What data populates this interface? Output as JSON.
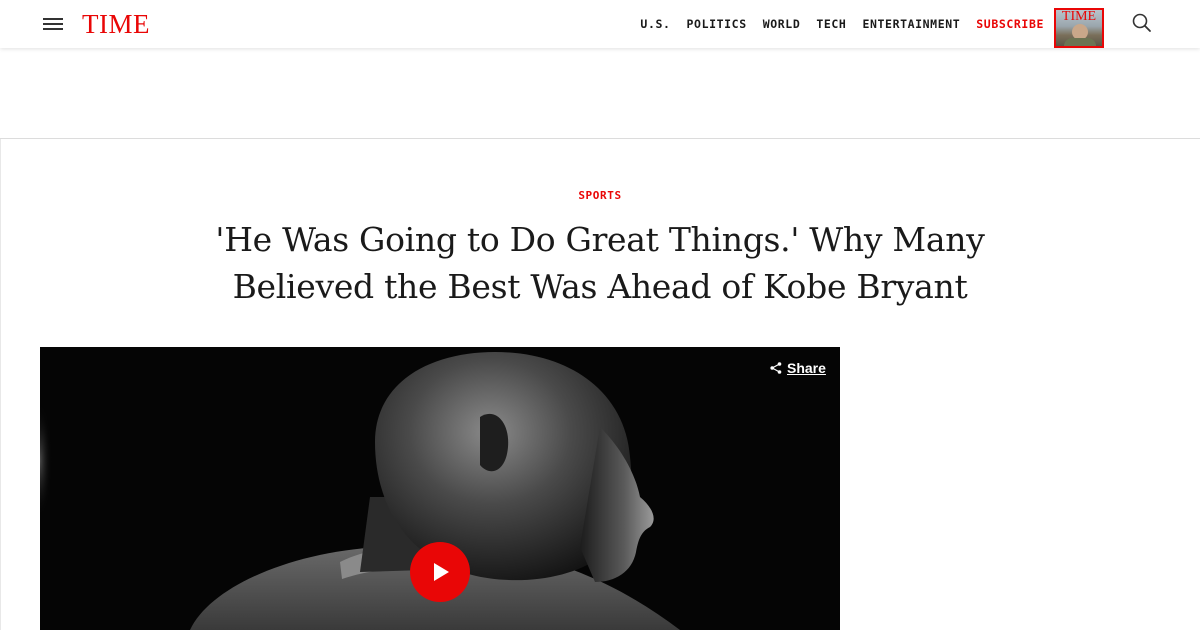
{
  "header": {
    "logo": "TIME",
    "nav": [
      {
        "label": "U.S."
      },
      {
        "label": "POLITICS"
      },
      {
        "label": "WORLD"
      },
      {
        "label": "TECH"
      },
      {
        "label": "ENTERTAINMENT"
      },
      {
        "label": "SUBSCRIBE"
      }
    ],
    "cover_logo": "TIME",
    "icons": {
      "menu": "hamburger-menu-icon",
      "search": "search-icon"
    },
    "accent_color": "#e90606"
  },
  "article": {
    "section": "SPORTS",
    "headline": "'He Was Going to Do Great Things.' Why Many Believed the Best Was Ahead of Kobe Bryant"
  },
  "video": {
    "share_label": "Share",
    "icons": {
      "share": "share-icon",
      "play": "play-icon"
    },
    "play_button_color": "#e90606"
  }
}
